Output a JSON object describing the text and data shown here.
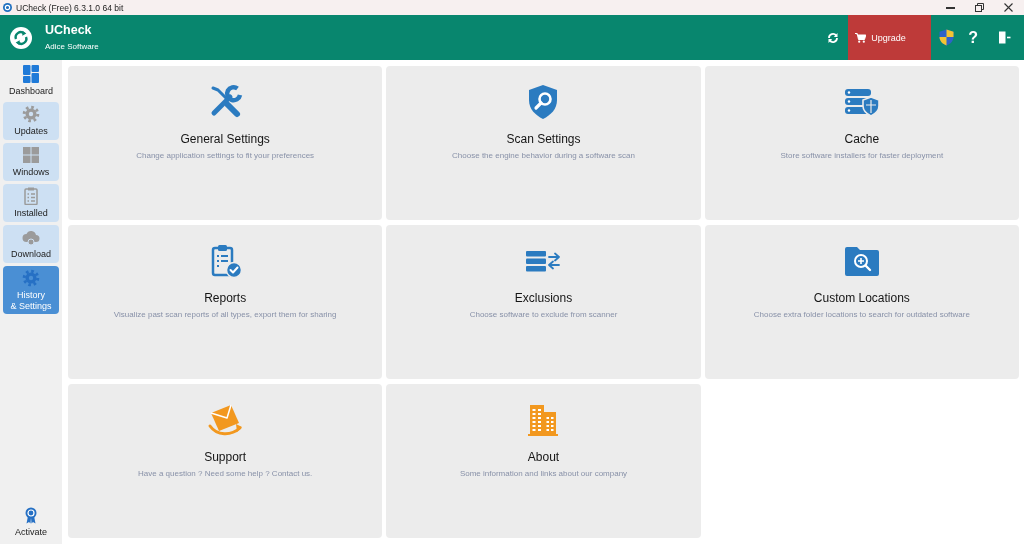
{
  "window": {
    "title": "UCheck (Free) 6.3.1.0 64 bit"
  },
  "header": {
    "app_name": "UCheck",
    "company": "Adice Software",
    "upgrade_button": "Upgrade",
    "help_button": "?"
  },
  "sidebar": {
    "items": [
      {
        "label": "Dashboard",
        "kind": "plain",
        "selected": false
      },
      {
        "label": "Updates",
        "kind": "tile",
        "selected": false
      },
      {
        "label": "Windows",
        "kind": "tile",
        "selected": false
      },
      {
        "label": "Installed",
        "kind": "tile",
        "selected": false
      },
      {
        "label": "Download",
        "kind": "tile",
        "selected": false
      },
      {
        "label": "History\n& Settings",
        "kind": "tile",
        "selected": true
      }
    ],
    "footer_button": "Activate"
  },
  "cards": [
    {
      "title": "General Settings",
      "description": "Change application settings to fit your preferences"
    },
    {
      "title": "Scan Settings",
      "description": "Choose the engine behavior during a software scan"
    },
    {
      "title": "Cache",
      "description": "Store software installers for faster deployment"
    },
    {
      "title": "Reports",
      "description": "Visualize past scan reports of all types, export them for sharing"
    },
    {
      "title": "Exclusions",
      "description": "Choose software to exclude from scanner"
    },
    {
      "title": "Custom Locations",
      "description": "Choose extra folder locations to search for outdated software"
    },
    {
      "title": "Support",
      "description": "Have a question ? Need some help ? Contact us."
    },
    {
      "title": "About",
      "description": "Some information and links about our company"
    }
  ]
}
